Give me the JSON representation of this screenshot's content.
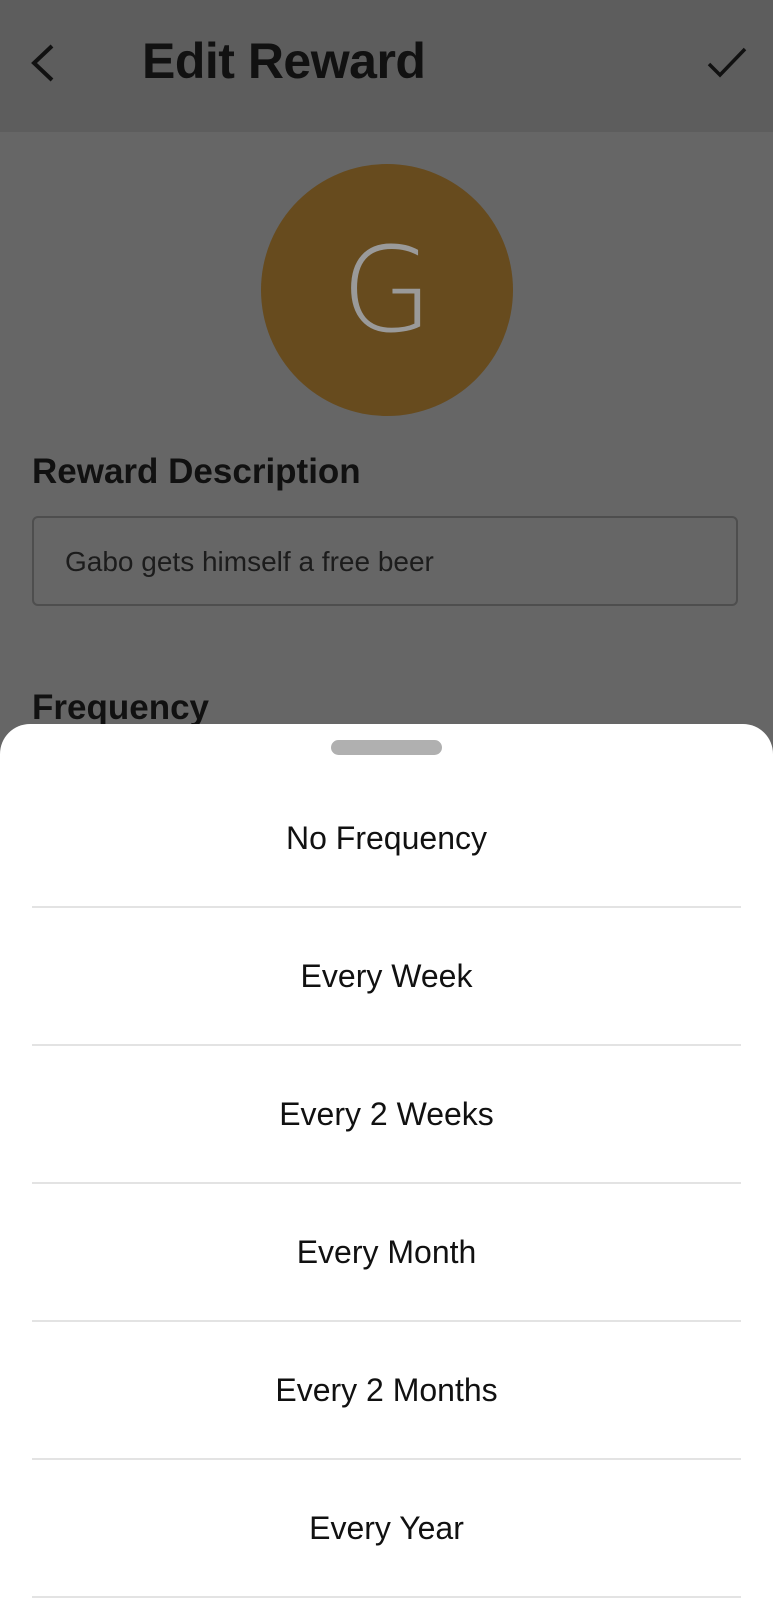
{
  "header": {
    "title": "Edit Reward",
    "back_icon": "chevron-left-icon",
    "save_icon": "check-icon"
  },
  "avatar": {
    "initial": "G",
    "color": "#674b1e"
  },
  "form": {
    "description_label": "Reward Description",
    "description_value": "Gabo gets himself a free beer",
    "frequency_label": "Frequency"
  },
  "sheet": {
    "options": [
      "No Frequency",
      "Every Week",
      "Every 2 Weeks",
      "Every Month",
      "Every 2 Months",
      "Every Year"
    ]
  }
}
